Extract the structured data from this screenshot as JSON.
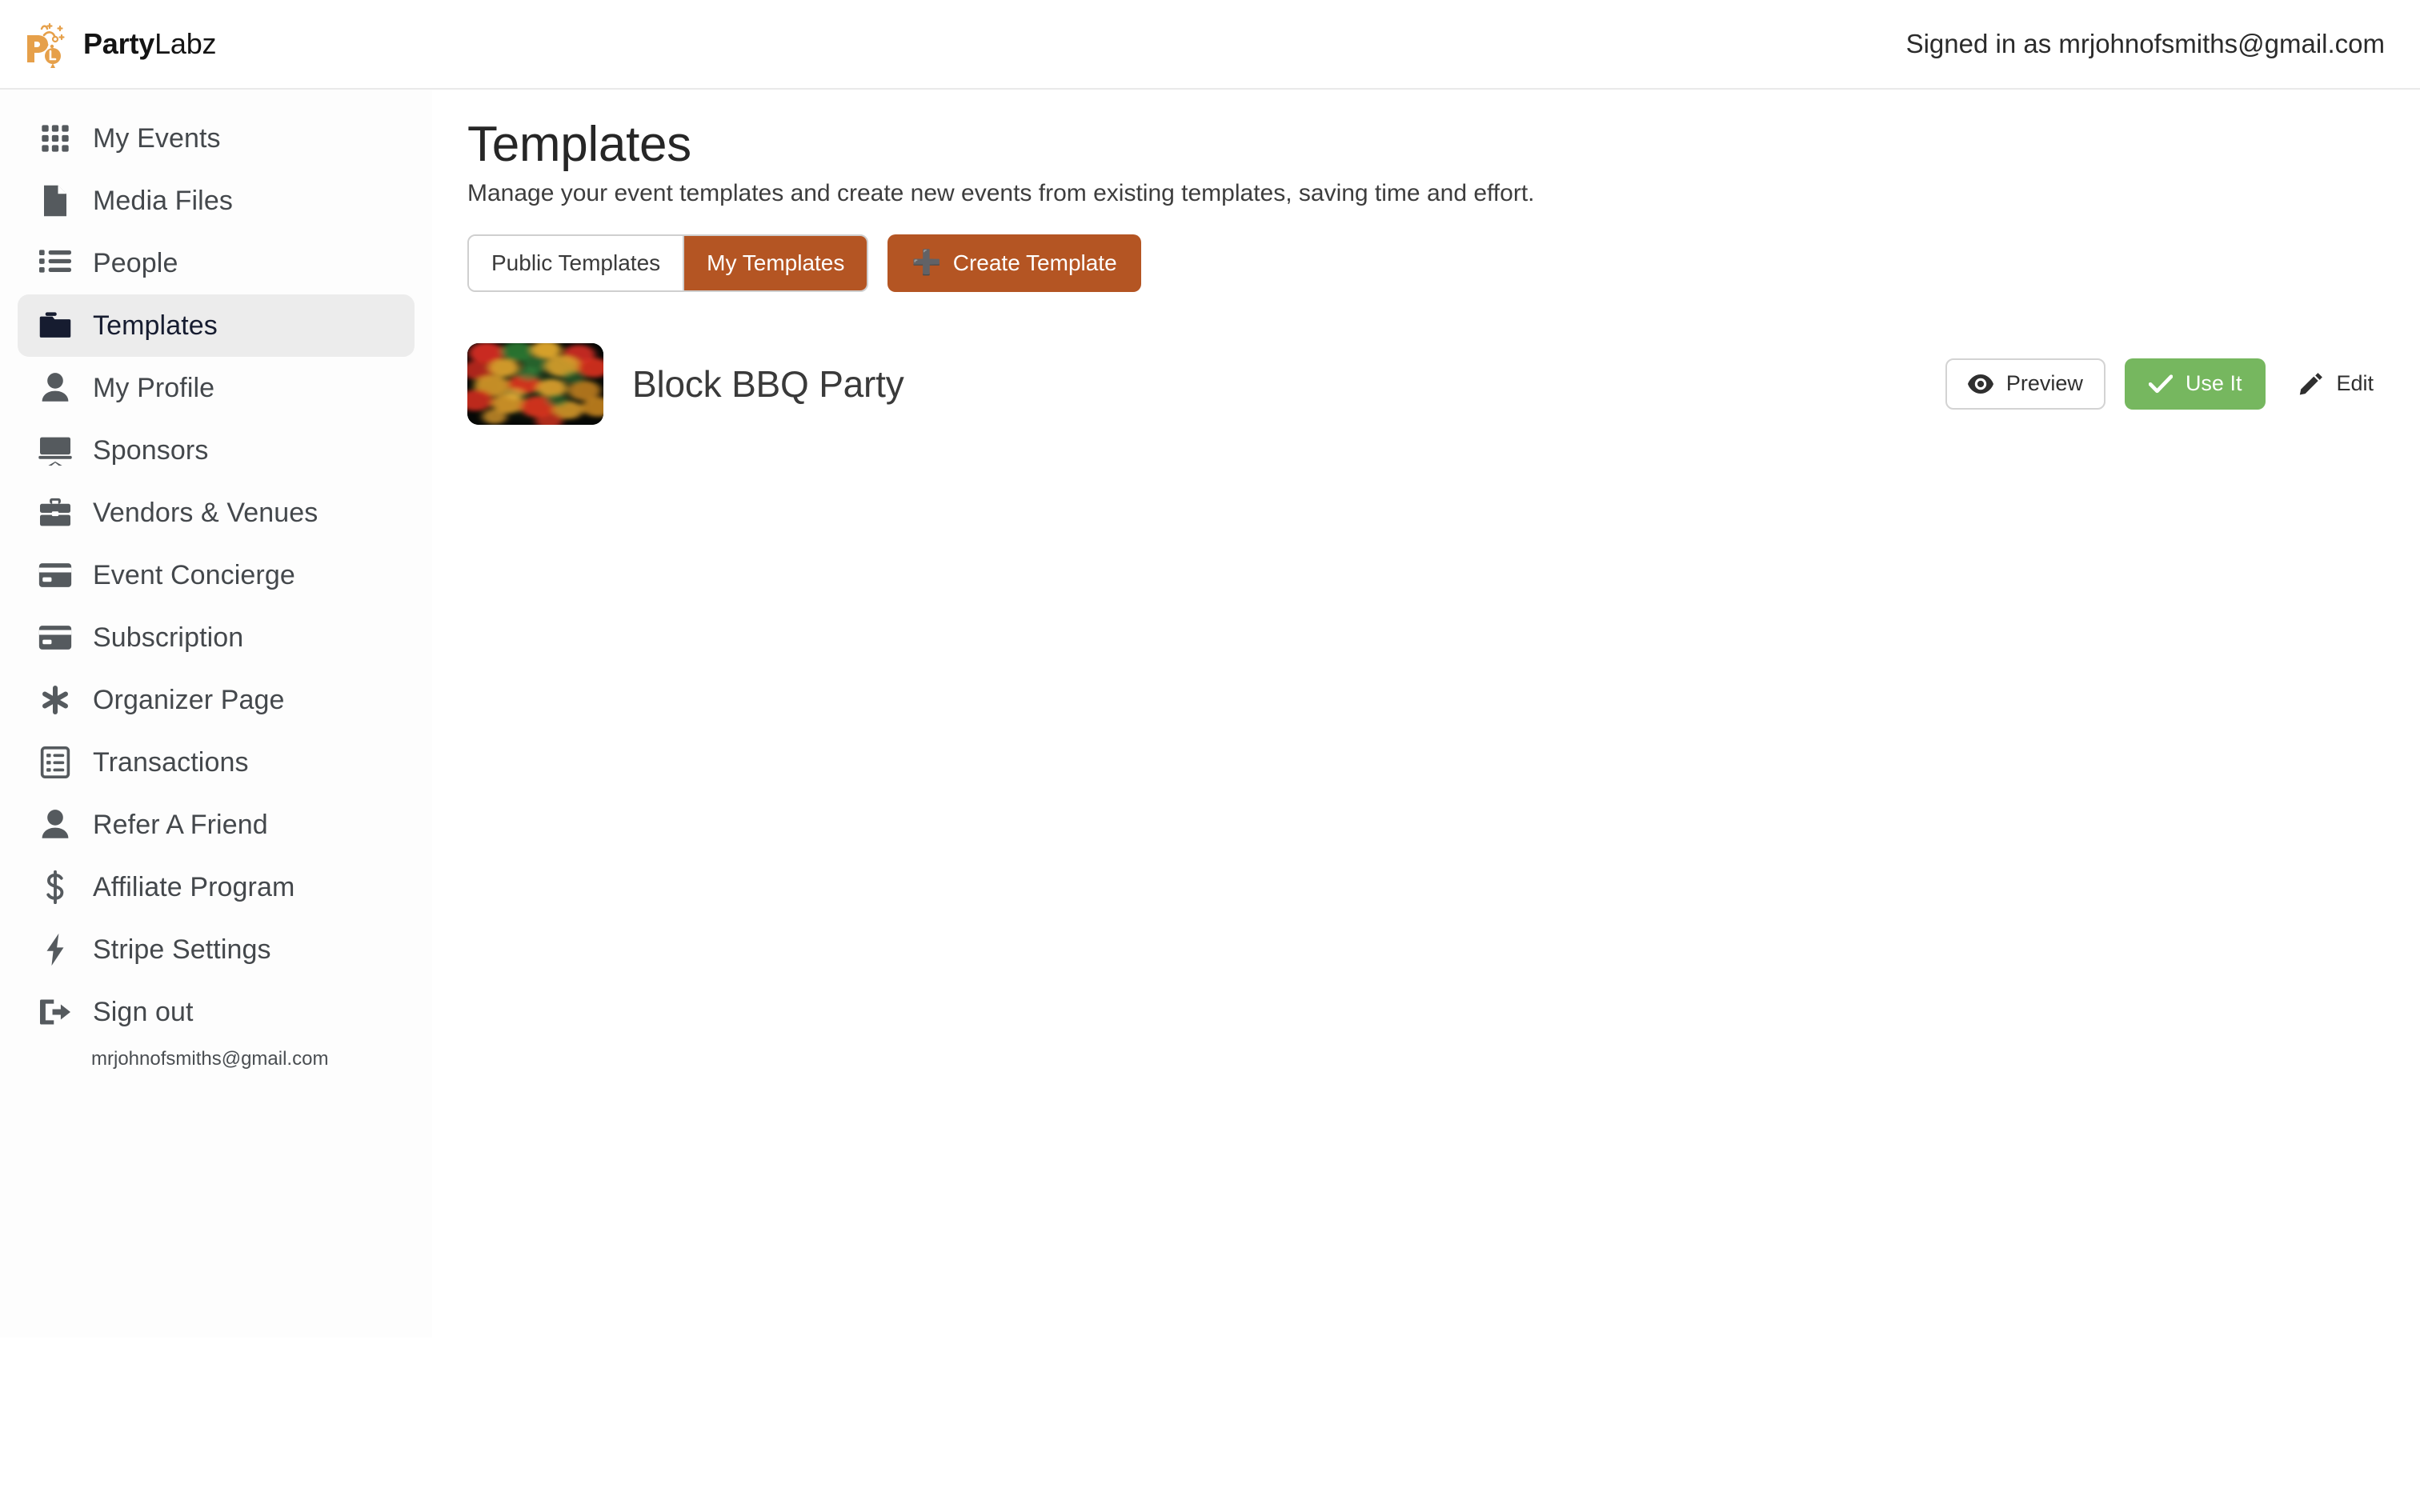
{
  "header": {
    "brand_bold": "Party",
    "brand_light": "Labz",
    "brand_logo_icon": "party-popper-balloon-logo",
    "signed_in_text": "Signed in as mrjohnofsmiths@gmail.com"
  },
  "colors": {
    "accent_orange": "#b45523",
    "success_green": "#76b75f",
    "active_nav_bg": "#ececec",
    "active_nav_fg": "#161c30",
    "brand_logo_orange": "#e6a04a"
  },
  "sidebar": {
    "items": [
      {
        "label": "My Events",
        "icon": "grid-icon",
        "active": false
      },
      {
        "label": "Media Files",
        "icon": "file-icon",
        "active": false
      },
      {
        "label": "People",
        "icon": "list-ul-icon",
        "active": false
      },
      {
        "label": "Templates",
        "icon": "folder-icon",
        "active": true
      },
      {
        "label": "My Profile",
        "icon": "user-icon",
        "active": false
      },
      {
        "label": "Sponsors",
        "icon": "projector-screen-icon",
        "active": false
      },
      {
        "label": "Vendors & Venues",
        "icon": "briefcase-icon",
        "active": false
      },
      {
        "label": "Event Concierge",
        "icon": "credit-card-icon",
        "active": false
      },
      {
        "label": "Subscription",
        "icon": "credit-card-icon",
        "active": false
      },
      {
        "label": "Organizer Page",
        "icon": "asterisk-icon",
        "active": false
      },
      {
        "label": "Transactions",
        "icon": "list-alt-icon",
        "active": false
      },
      {
        "label": "Refer A Friend",
        "icon": "user-icon",
        "active": false
      },
      {
        "label": "Affiliate Program",
        "icon": "dollar-sign-icon",
        "active": false
      },
      {
        "label": "Stripe Settings",
        "icon": "bolt-icon",
        "active": false
      },
      {
        "label": "Sign out",
        "icon": "sign-out-icon",
        "active": false
      }
    ],
    "signout_email": "mrjohnofsmiths@gmail.com"
  },
  "main": {
    "title": "Templates",
    "subtitle": "Manage your event templates and create new events from existing templates, saving time and effort.",
    "tabs": [
      {
        "label": "Public Templates",
        "active": false
      },
      {
        "label": "My Templates",
        "active": true
      }
    ],
    "create_button": {
      "label": "Create Template",
      "icon": "plus-icon"
    },
    "templates": [
      {
        "name": "Block BBQ Party",
        "thumbnail_icon": "bokeh-lights-thumbnail",
        "actions": [
          {
            "label": "Preview",
            "icon": "eye-icon",
            "style": "outline"
          },
          {
            "label": "Use It",
            "icon": "check-icon",
            "style": "green"
          },
          {
            "label": "Edit",
            "icon": "pencil-icon",
            "style": "plain"
          }
        ]
      }
    ]
  }
}
